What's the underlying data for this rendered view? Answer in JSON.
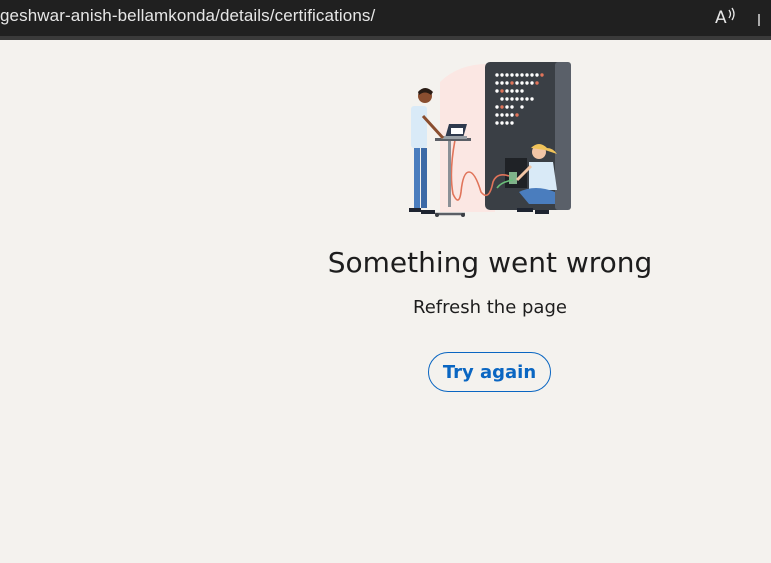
{
  "browser": {
    "url": "geshwar-anish-bellamkonda/details/certifications/",
    "read_aloud_icon": "read-aloud-icon"
  },
  "error": {
    "title": "Something went wrong",
    "subtitle": "Refresh the page",
    "button_label": "Try again",
    "accent_color": "#0a66c2",
    "illustration": "server-room-technicians-illustration"
  }
}
